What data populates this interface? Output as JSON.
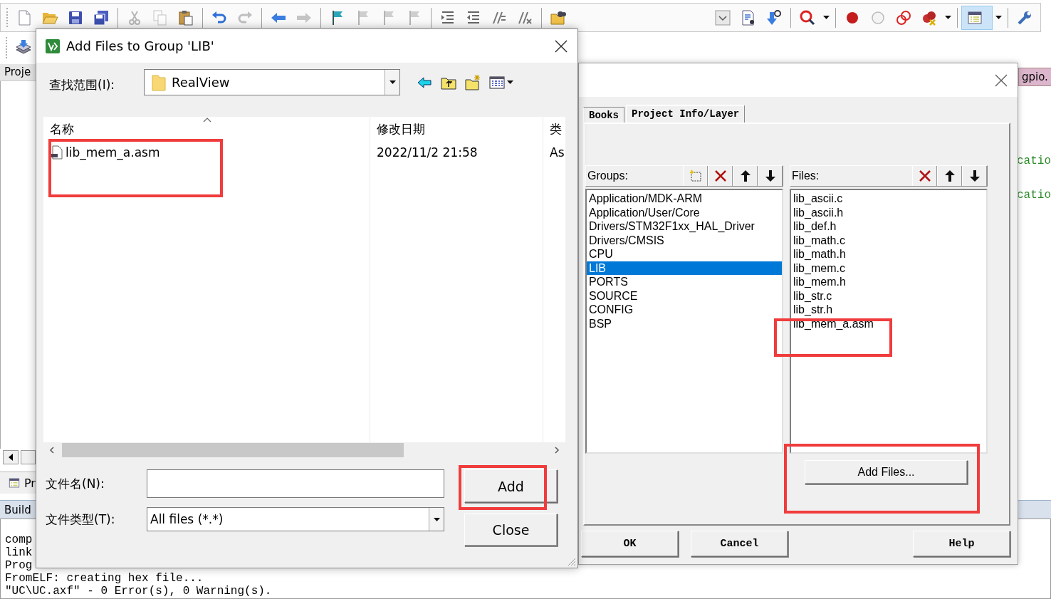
{
  "toolbar": [
    {
      "kind": "new",
      "disabled": false
    },
    {
      "kind": "open",
      "disabled": false
    },
    {
      "kind": "save",
      "disabled": false
    },
    {
      "kind": "save_all",
      "disabled": false
    },
    {
      "kind": "separator"
    },
    {
      "kind": "cut",
      "disabled": true
    },
    {
      "kind": "copy",
      "disabled": true
    },
    {
      "kind": "paste",
      "disabled": false
    },
    {
      "kind": "separator"
    },
    {
      "kind": "undo",
      "disabled": false
    },
    {
      "kind": "redo",
      "disabled": true
    },
    {
      "kind": "separator"
    },
    {
      "kind": "back",
      "disabled": false
    },
    {
      "kind": "forward",
      "disabled": true
    },
    {
      "kind": "separator"
    },
    {
      "kind": "bookmark",
      "disabled": false
    },
    {
      "kind": "bookmark_prev",
      "disabled": true
    },
    {
      "kind": "bookmark_next",
      "disabled": true
    },
    {
      "kind": "bookmark_clear",
      "disabled": true
    },
    {
      "kind": "separator"
    },
    {
      "kind": "indent",
      "disabled": false
    },
    {
      "kind": "unindent",
      "disabled": false
    },
    {
      "kind": "comment",
      "disabled": false
    },
    {
      "kind": "uncomment",
      "disabled": false
    },
    {
      "kind": "separator"
    },
    {
      "kind": "find_in_files",
      "disabled": false
    }
  ],
  "toolbar_right": [
    {
      "kind": "dropdown_box",
      "disabled": false,
      "pressed": false
    },
    {
      "kind": "find_doc",
      "disabled": false,
      "pressed": false
    },
    {
      "kind": "download_find",
      "disabled": false,
      "pressed": false
    },
    {
      "kind": "separator"
    },
    {
      "kind": "debug",
      "disabled": false,
      "pressed": false
    },
    {
      "kind": "menu_caret"
    },
    {
      "kind": "separator"
    },
    {
      "kind": "breakpoint",
      "disabled": false,
      "pressed": false
    },
    {
      "kind": "breakpoint_off",
      "disabled": false,
      "pressed": false
    },
    {
      "kind": "breakpoints_disable",
      "disabled": false,
      "pressed": false
    },
    {
      "kind": "breakpoints_kill",
      "disabled": false,
      "pressed": false
    },
    {
      "kind": "menu_caret"
    },
    {
      "kind": "separator"
    },
    {
      "kind": "window",
      "disabled": false,
      "pressed": true
    },
    {
      "kind": "menu_caret"
    },
    {
      "kind": "separator"
    },
    {
      "kind": "wrench",
      "disabled": false,
      "pressed": false
    }
  ],
  "toolbar_2": [
    {
      "kind": "batch",
      "disabled": false
    }
  ],
  "project_panel": {
    "title": "Proje",
    "tab": "Pr"
  },
  "build_panel": {
    "title": "Build",
    "lines": [
      "comp",
      "link",
      "Prog",
      "FromELF: creating hex file...",
      "\"UC\\UC.axf\" - 0 Error(s), 0 Warning(s)."
    ]
  },
  "editor": {
    "tab": "gpio.",
    "lines": [
      "catio",
      "catio"
    ]
  },
  "options_dialog": {
    "tabs": [
      {
        "label": "Books",
        "selected": false
      },
      {
        "label": "Project Info/Layer",
        "selected": true
      }
    ],
    "groups_label": "Groups:",
    "groups": [
      {
        "label": "Application/MDK-ARM",
        "selected": false
      },
      {
        "label": "Application/User/Core",
        "selected": false
      },
      {
        "label": "Drivers/STM32F1xx_HAL_Driver",
        "selected": false
      },
      {
        "label": "Drivers/CMSIS",
        "selected": false
      },
      {
        "label": "CPU",
        "selected": false
      },
      {
        "label": "LIB",
        "selected": true
      },
      {
        "label": "PORTS",
        "selected": false
      },
      {
        "label": "SOURCE",
        "selected": false
      },
      {
        "label": "CONFIG",
        "selected": false
      },
      {
        "label": "BSP",
        "selected": false
      }
    ],
    "files_label": "Files:",
    "files": [
      "lib_ascii.c",
      "lib_ascii.h",
      "lib_def.h",
      "lib_math.c",
      "lib_math.h",
      "lib_mem.c",
      "lib_mem.h",
      "lib_str.c",
      "lib_str.h",
      "lib_mem_a.asm"
    ],
    "add_files_button": "Add Files...",
    "buttons": [
      "OK",
      "Cancel",
      "Help"
    ]
  },
  "file_dialog": {
    "title": "Add Files to Group 'LIB'",
    "look_in_label": "查找范围(I):",
    "look_in_value": "RealView",
    "columns": [
      "名称",
      "修改日期",
      "类"
    ],
    "rows": [
      {
        "cells": [
          "lib_mem_a.asm",
          "2022/11/2 21:58",
          "As"
        ]
      }
    ],
    "filename_label": "文件名(N):",
    "filetype_label": "文件类型(T):",
    "filetype_value": "All files (*.*)",
    "add_button": "Add",
    "close_button": "Close"
  }
}
